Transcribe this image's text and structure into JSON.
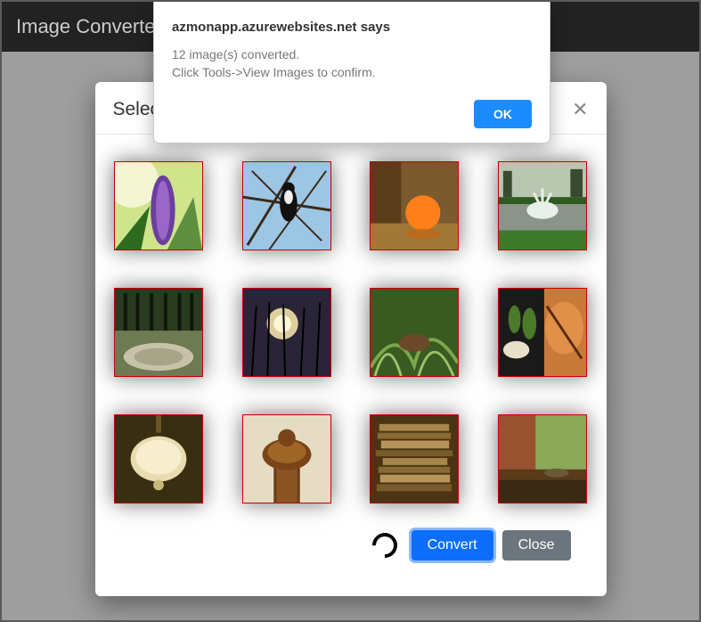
{
  "header": {
    "brand": "Image Converter"
  },
  "modal": {
    "title": "Select Images to Convert",
    "close_aria": "Close",
    "convert_label": "Convert",
    "close_label": "Close",
    "thumbs": [
      {
        "name": "image-1-purple-flower"
      },
      {
        "name": "image-2-bird-branches"
      },
      {
        "name": "image-3-orange-fruit"
      },
      {
        "name": "image-4-fountain-lawn"
      },
      {
        "name": "image-5-forest-stream"
      },
      {
        "name": "image-6-sunset-reeds"
      },
      {
        "name": "image-7-green-grass-closeup"
      },
      {
        "name": "image-8-grilled-food"
      },
      {
        "name": "image-9-pendant-lamp"
      },
      {
        "name": "image-10-wood-finial"
      },
      {
        "name": "image-11-stacked-books"
      },
      {
        "name": "image-12-lizard-ledge"
      }
    ]
  },
  "alert": {
    "source": "azmonapp.azurewebsites.net says",
    "line1": "12 image(s) converted.",
    "line2": "Click Tools->View Images to confirm.",
    "ok_label": "OK"
  }
}
